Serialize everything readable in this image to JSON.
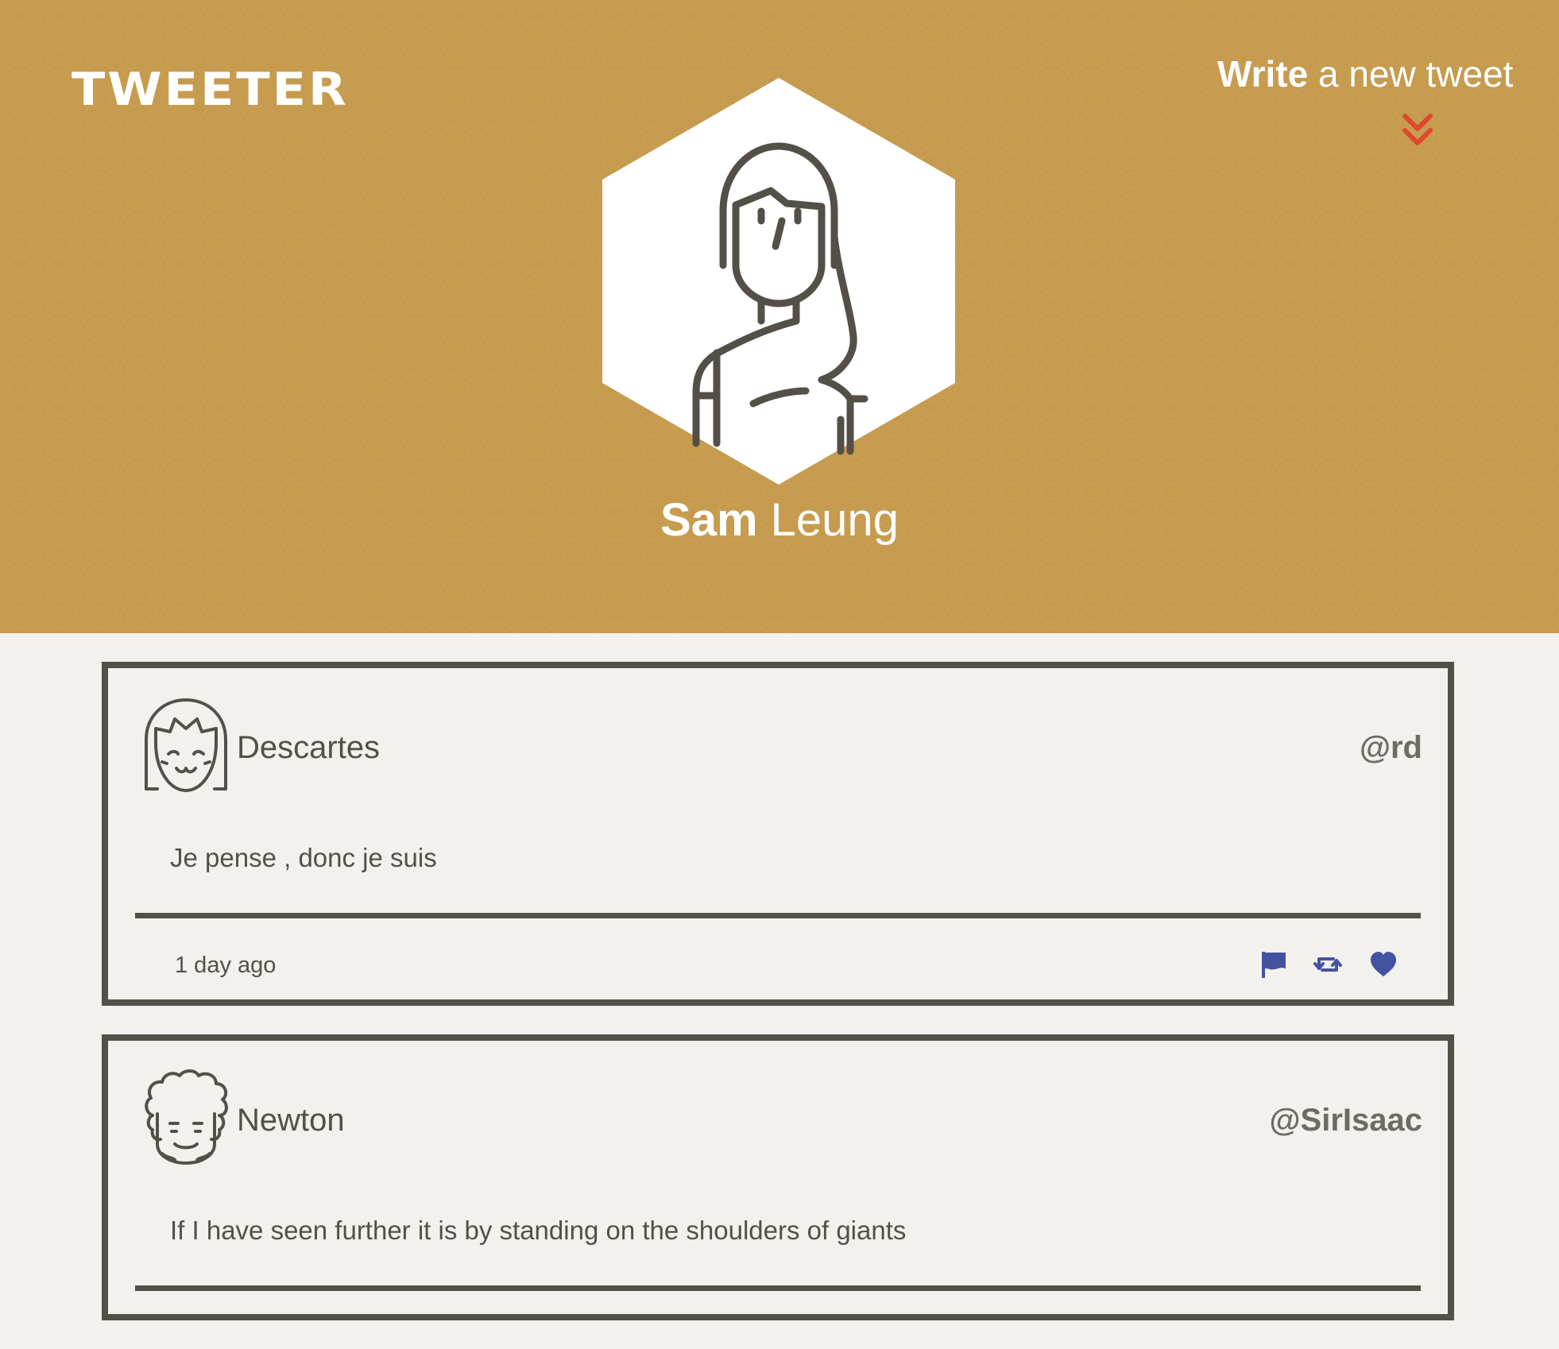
{
  "app": {
    "logo": "TWEETER"
  },
  "compose": {
    "strong": "Write",
    "rest": " a new tweet",
    "icon": "double-chevron-down-icon",
    "icon_color": "#e1462b"
  },
  "profile": {
    "first_name": "Sam",
    "last_name": " Leung",
    "avatar_icon": "woman-avatar-icon"
  },
  "colors": {
    "header_bg": "#c69b4e",
    "page_bg": "#f3f1ed",
    "ink": "#545048",
    "action_blue": "#4453a1"
  },
  "tweets": [
    {
      "name": "Descartes",
      "handle": "@rd",
      "avatar_icon": "girl-face-avatar-icon",
      "text": "Je pense , donc je suis",
      "time": "1 day ago",
      "actions": [
        "flag-icon",
        "retweet-icon",
        "heart-icon"
      ]
    },
    {
      "name": "Newton",
      "handle": "@SirIsaac",
      "avatar_icon": "curly-hair-face-avatar-icon",
      "text": "If I have seen further it is by standing on the shoulders of giants"
    }
  ]
}
